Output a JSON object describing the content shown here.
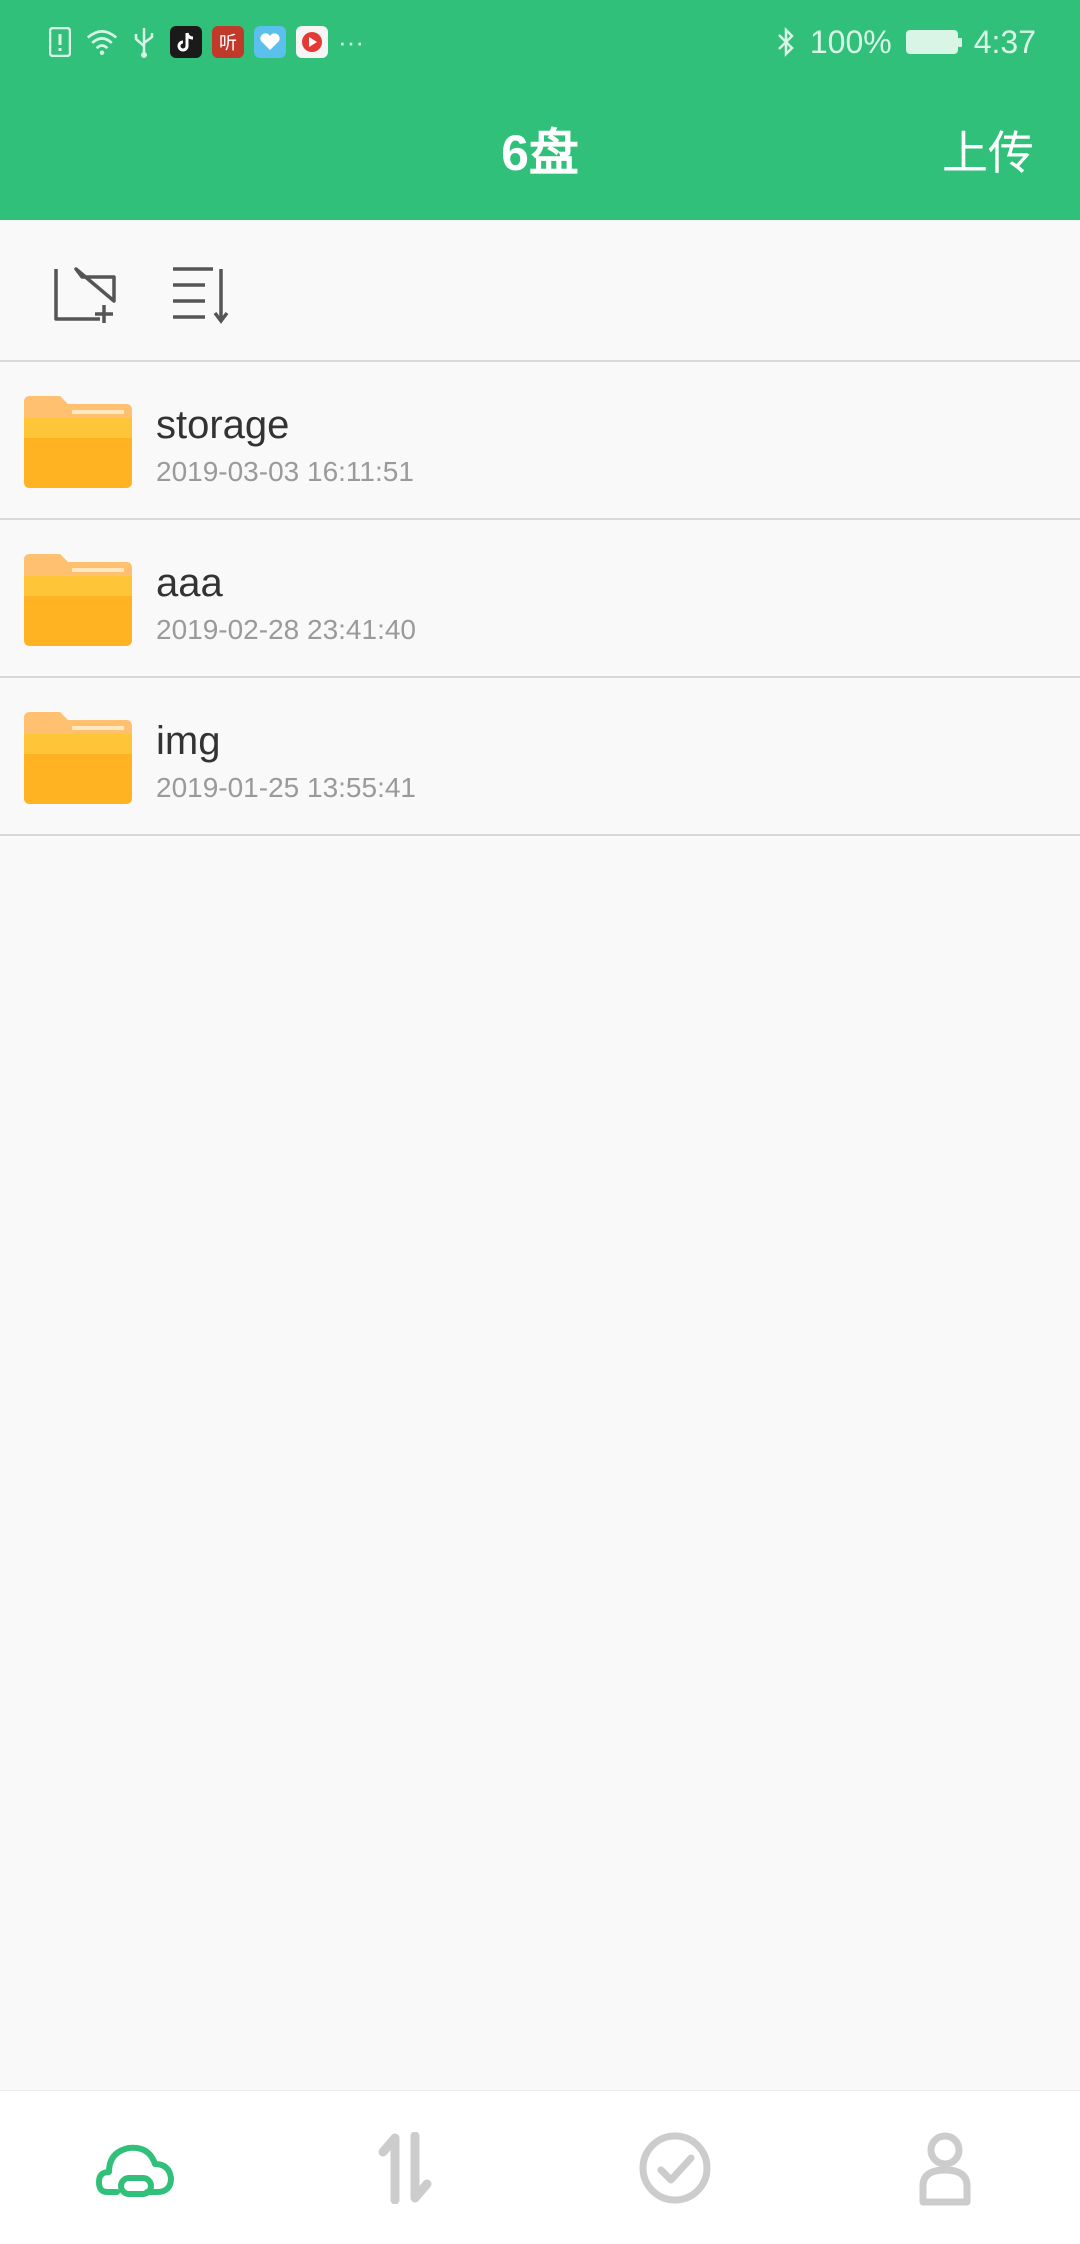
{
  "status_bar": {
    "battery_percent": "100%",
    "time": "4:37",
    "left_icons": [
      "alert-icon",
      "wifi-icon",
      "usb-icon",
      "tiktok-icon",
      "ting-app-icon",
      "heart-app-icon",
      "video-app-icon",
      "more-dots-icon"
    ],
    "app_icon_label": "听",
    "more": "···"
  },
  "header": {
    "title": "6盘",
    "upload_label": "上传"
  },
  "toolbar": {
    "icons": [
      "new-folder-icon",
      "sort-icon"
    ]
  },
  "files": [
    {
      "name": "storage",
      "date": "2019-03-03 16:11:51",
      "icon": "folder-icon"
    },
    {
      "name": "aaa",
      "date": "2019-02-28 23:41:40",
      "icon": "folder-icon"
    },
    {
      "name": "img",
      "date": "2019-01-25 13:55:41",
      "icon": "folder-icon"
    }
  ],
  "bottom_nav": {
    "items": [
      {
        "icon": "cloud-icon",
        "active": true
      },
      {
        "icon": "transfer-icon",
        "active": false
      },
      {
        "icon": "check-circle-icon",
        "active": false
      },
      {
        "icon": "person-icon",
        "active": false
      }
    ]
  },
  "colors": {
    "accent": "#30c07a",
    "folder_top": "#ffc878",
    "folder_body": "#ffb020",
    "nav_inactive": "#cccccc"
  }
}
